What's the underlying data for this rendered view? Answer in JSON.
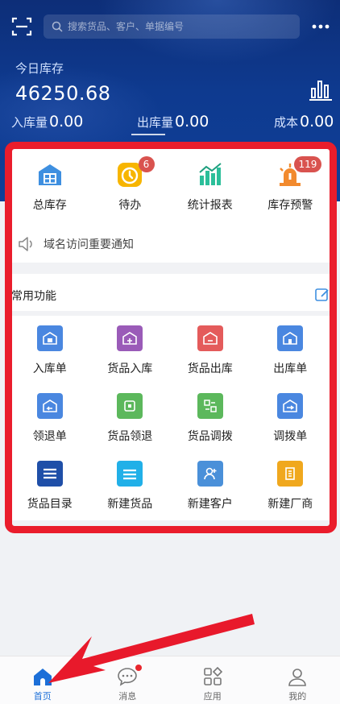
{
  "search": {
    "placeholder": "搜索货品、客户、单据编号"
  },
  "summary": {
    "title": "今日库存",
    "total": "46250.68",
    "stats": [
      {
        "label": "入库量",
        "value": "0.00"
      },
      {
        "label": "出库量",
        "value": "0.00"
      },
      {
        "label": "成本",
        "value": "0.00"
      }
    ]
  },
  "quick": [
    {
      "label": "总库存",
      "icon": "warehouse-icon",
      "badge": ""
    },
    {
      "label": "待办",
      "icon": "timer-icon",
      "badge": "6"
    },
    {
      "label": "统计报表",
      "icon": "bar-chart-icon",
      "badge": ""
    },
    {
      "label": "库存预警",
      "icon": "alarm-icon",
      "badge": "119"
    }
  ],
  "notice": {
    "text": "域名访问重要通知",
    "icon": "speaker-icon"
  },
  "common": {
    "title": "常用功能",
    "items": [
      {
        "label": "入库单",
        "icon": "inbound-order-icon",
        "color": "#4a87e0"
      },
      {
        "label": "货品入库",
        "icon": "goods-inbound-icon",
        "color": "#9a5bb8"
      },
      {
        "label": "货品出库",
        "icon": "goods-outbound-icon",
        "color": "#e45b5b"
      },
      {
        "label": "出库单",
        "icon": "outbound-order-icon",
        "color": "#4a87e0"
      },
      {
        "label": "领退单",
        "icon": "return-order-icon",
        "color": "#4a87e0"
      },
      {
        "label": "货品领退",
        "icon": "goods-return-icon",
        "color": "#5cb85c"
      },
      {
        "label": "货品调拨",
        "icon": "goods-transfer-icon",
        "color": "#5cb85c"
      },
      {
        "label": "调拨单",
        "icon": "transfer-order-icon",
        "color": "#4a87e0"
      },
      {
        "label": "货品目录",
        "icon": "catalog-icon",
        "color": "#1f4fa8"
      },
      {
        "label": "新建货品",
        "icon": "new-goods-icon",
        "color": "#21b0e8"
      },
      {
        "label": "新建客户",
        "icon": "new-customer-icon",
        "color": "#4a90d9"
      },
      {
        "label": "新建厂商",
        "icon": "new-vendor-icon",
        "color": "#f0a81e"
      }
    ]
  },
  "tabs": [
    {
      "label": "首页",
      "icon": "home-icon"
    },
    {
      "label": "消息",
      "icon": "message-icon"
    },
    {
      "label": "应用",
      "icon": "apps-icon"
    },
    {
      "label": "我的",
      "icon": "user-icon"
    }
  ],
  "colors": {
    "accent": "#1c6fd8",
    "highlight_box": "#ea1d2c",
    "header": "#0e3a8f"
  }
}
